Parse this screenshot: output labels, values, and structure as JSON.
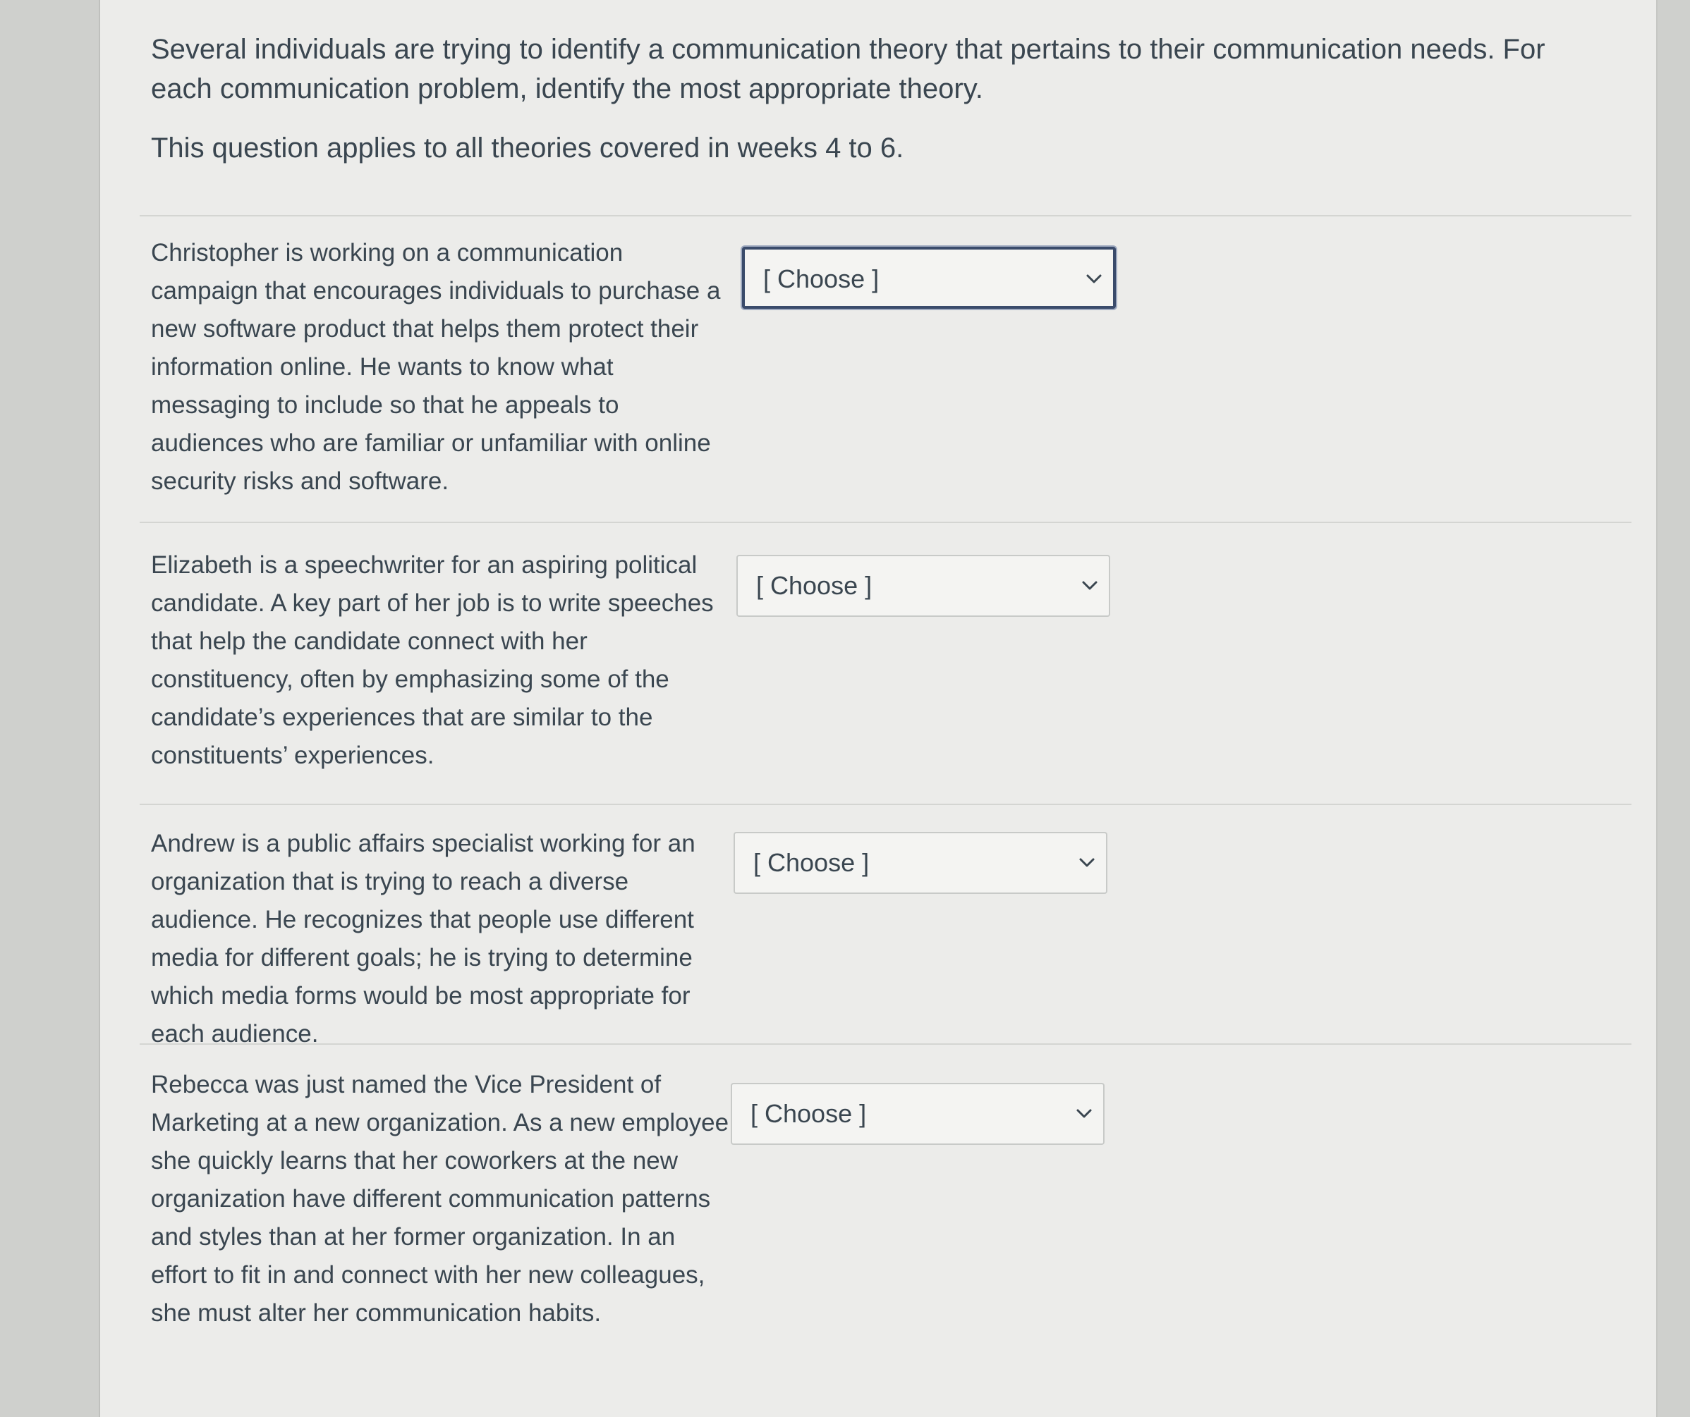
{
  "intro": {
    "paragraph1": "Several individuals are trying to identify a communication theory that pertains to their communication needs. For each communication problem, identify the most appropriate theory.",
    "paragraph2": "This question applies to all theories covered in weeks 4 to 6."
  },
  "questions": [
    {
      "text": "Christopher is working on a communication campaign that encourages individuals to purchase a new software product that helps them protect their information online. He wants to know what messaging to include so that he appeals to audiences who are familiar or unfamiliar with online security risks and software.",
      "select_value": "[ Choose ]"
    },
    {
      "text": "Elizabeth is a speechwriter for an aspiring political candidate. A key part of her job is to write speeches that help the candidate connect with her constituency, often by emphasizing some of the candidate’s experiences that are similar to the constituents’ experiences.",
      "select_value": "[ Choose ]"
    },
    {
      "text": "Andrew is a public affairs specialist working for an organization that is trying to reach a diverse audience. He recognizes that people use different media for different goals; he is trying to determine which media forms would be most appropriate for each audience.",
      "select_value": "[ Choose ]"
    },
    {
      "text": "Rebecca was just named the Vice President of Marketing at a new organization. As a new employee, she quickly learns that her coworkers at the new organization have different communication patterns and styles than at her former organization. In an effort to fit in and connect with her new colleagues, she must alter her communication habits.",
      "select_value": "[ Choose ]"
    }
  ],
  "icons": {
    "dropdown": "chevron-down-icon"
  },
  "colors": {
    "focus_border": "#3a4b6b",
    "text": "#3a4650",
    "background": "#ececea"
  }
}
